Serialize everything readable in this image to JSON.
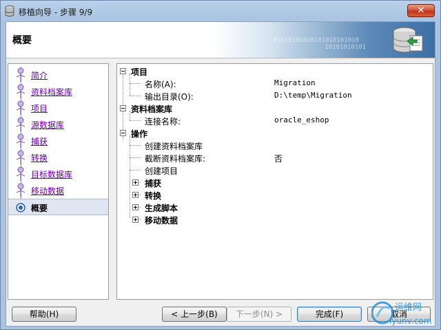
{
  "window": {
    "title": "移植向导 - 步骤 9/9",
    "close_label": "✕"
  },
  "header": {
    "title": "概要",
    "binary_line1": "01010101010101010101010",
    "binary_line2": "10101010101"
  },
  "steps": [
    {
      "label": "简介",
      "active": false
    },
    {
      "label": "资料档案库",
      "active": false
    },
    {
      "label": "项目",
      "active": false
    },
    {
      "label": "源数据库",
      "active": false
    },
    {
      "label": "捕获",
      "active": false
    },
    {
      "label": "转换",
      "active": false
    },
    {
      "label": "目标数据库",
      "active": false
    },
    {
      "label": "移动数据",
      "active": false
    },
    {
      "label": "概要",
      "active": true
    }
  ],
  "tree": {
    "project": {
      "label": "项目",
      "name_label": "名称(A):",
      "name_value": "Migration",
      "output_label": "输出目录(O):",
      "output_value": "D:\\temp\\Migration"
    },
    "repository": {
      "label": "资料档案库",
      "conn_label": "连接名称:",
      "conn_value": "oracle_eshop"
    },
    "operations": {
      "label": "操作",
      "create_repo": "创建资料档案库",
      "truncate_label": "截断资料档案库:",
      "truncate_value": "否",
      "create_project": "创建项目",
      "capture": "捕获",
      "convert": "转换",
      "gen_script": "生成脚本",
      "move_data": "移动数据"
    }
  },
  "buttons": {
    "help": "帮助(H)",
    "back": "< 上一步(B)",
    "next": "下一步(N) >",
    "finish": "完成(F)",
    "cancel": "取消"
  },
  "watermark": {
    "text1": "运维网",
    "text2": "iyunv.com"
  }
}
